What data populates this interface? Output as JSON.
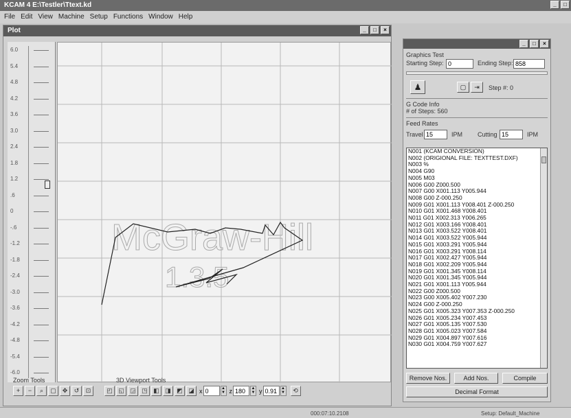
{
  "app": {
    "title": "KCAM 4  E:\\Testler\\Ttext.kd"
  },
  "menu": [
    "File",
    "Edit",
    "View",
    "Machine",
    "Setup",
    "Functions",
    "Window",
    "Help"
  ],
  "plot": {
    "title": "Plot",
    "ruler_ticks": [
      "6.0",
      "5.4",
      "4.8",
      "4.2",
      "3.6",
      "3.0",
      "2.4",
      "1.8",
      "1.2",
      ".6",
      "0",
      "-.6",
      "-1.2",
      "-1.8",
      "-2.4",
      "-3.0",
      "-3.6",
      "-4.2",
      "-4.8",
      "-5.4",
      "-6.0"
    ],
    "watermark_text": "McGraw-Hill",
    "watermark_sub": "1.3.5",
    "zoom_label": "Zoom Tools",
    "viewport_label": "3D Viewport Tools",
    "x_rot": "0",
    "z_rot": "180",
    "y_rot": "0.91"
  },
  "graphics_test": {
    "title": "Graphics Test",
    "starting_step_label": "Starting Step:",
    "starting_step_value": "0",
    "ending_step_label": "Ending Step:",
    "ending_step_value": "858",
    "step_label": "Step #:",
    "step_value": "0"
  },
  "gcode_info": {
    "title": "G Code Info",
    "steps_label": "# of Steps:",
    "steps_value": "560"
  },
  "feed_rates": {
    "title": "Feed Rates",
    "travel_label": "Travel",
    "travel_value": "15",
    "travel_unit": "IPM",
    "cutting_label": "Cutting",
    "cutting_value": "15",
    "cutting_unit": "IPM"
  },
  "code_lines": [
    "N001 (KCAM CONVERSION)",
    "N002 (ORIGIONAL FILE: TEXTTEST.DXF)",
    "N003 %",
    "N004 G90",
    "N005 M03",
    "N006 G00 Z000.500",
    "N007 G00 X001.113 Y005.944",
    "N008 G00 Z-000.250",
    "N009 G01 X001.113 Y008.401 Z-000.250",
    "N010 G01 X001.468 Y008.401",
    "N011 G01 X002.313 Y006.265",
    "N012 G01 X003.166 Y008.401",
    "N013 G01 X003.522 Y008.401",
    "N014 G01 X003.522 Y005.944",
    "N015 G01 X003.291 Y005.944",
    "N016 G01 X003.291 Y008.114",
    "N017 G01 X002.427 Y005.944",
    "N018 G01 X002.209 Y005.944",
    "N019 G01 X001.345 Y008.114",
    "N020 G01 X001.345 Y005.944",
    "N021 G01 X001.113 Y005.944",
    "N022 G00 Z000.500",
    "N023 G00 X005.402 Y007.230",
    "N024 G00 Z-000.250",
    "N025 G01 X005.323 Y007.353 Z-000.250",
    "N026 G01 X005.234 Y007.453",
    "N027 G01 X005.135 Y007.530",
    "N028 G01 X005.023 Y007.584",
    "N029 G01 X004.897 Y007.616",
    "N030 G01 X004.759 Y007.627"
  ],
  "buttons": {
    "remove_nos": "Remove Nos.",
    "add_nos": "Add Nos.",
    "compile": "Compile",
    "decimal_format": "Decimal Format"
  },
  "status": {
    "time": "000:07:10.2108",
    "setup": "Setup: Default_Machine"
  }
}
